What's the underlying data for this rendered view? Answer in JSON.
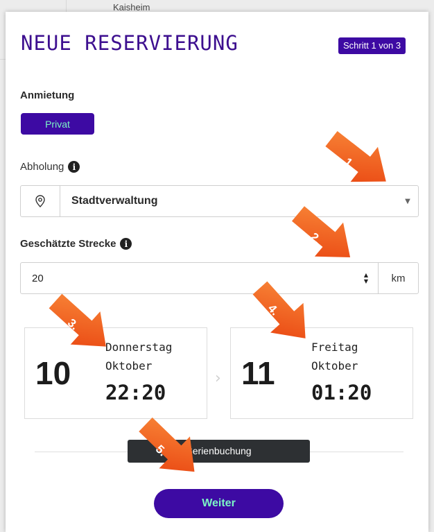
{
  "map": {
    "place_label": "Kaisheim"
  },
  "header": {
    "title": "NEUE RESERVIERUNG",
    "step": "Schritt 1 von 3"
  },
  "rental": {
    "label": "Anmietung",
    "type_button": "Privat"
  },
  "pickup": {
    "label": "Abholung",
    "value": "Stadtverwaltung",
    "icon": "map-pin-icon"
  },
  "distance": {
    "label": "Geschätzte Strecke",
    "value": "20",
    "unit": "km"
  },
  "start_date": {
    "day": "10",
    "weekday": "Donnerstag",
    "month": "Oktober",
    "time": "22:20"
  },
  "end_date": {
    "day": "11",
    "weekday": "Freitag",
    "month": "Oktober",
    "time": "01:20"
  },
  "series_booking_label": "Serienbuchung",
  "next_button": "Weiter",
  "annotations": [
    {
      "number": "1."
    },
    {
      "number": "2."
    },
    {
      "number": "3."
    },
    {
      "number": "4."
    },
    {
      "number": "5."
    }
  ],
  "colors": {
    "brand_purple": "#3d0aa3",
    "accent_mint": "#7cf6c6",
    "arrow_orange": "#f05a18"
  }
}
